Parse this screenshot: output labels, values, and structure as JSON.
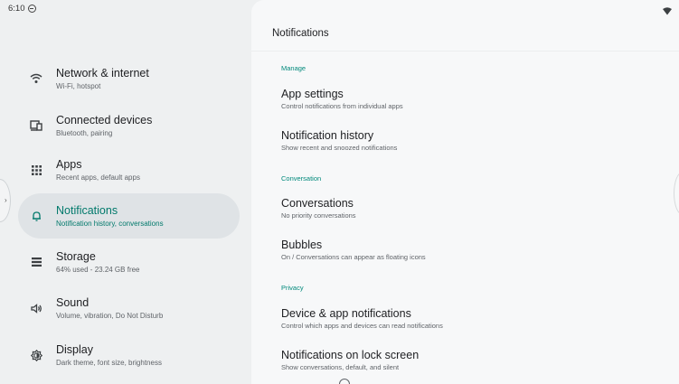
{
  "status_bar": {
    "time": "6:10",
    "icons": [
      "vpn-icon",
      "wifi-icon"
    ]
  },
  "sidebar": {
    "items": [
      {
        "title": "Network & internet",
        "subtitle": "Wi-Fi, hotspot",
        "icon": "wifi-icon",
        "active": false
      },
      {
        "title": "Connected devices",
        "subtitle": "Bluetooth, pairing",
        "icon": "connected-devices-icon",
        "active": false
      },
      {
        "title": "Apps",
        "subtitle": "Recent apps, default apps",
        "icon": "apps-grid-icon",
        "active": false
      },
      {
        "title": "Notifications",
        "subtitle": "Notification history, conversations",
        "icon": "bell-icon",
        "active": true
      },
      {
        "title": "Storage",
        "subtitle": "64% used - 23.24 GB free",
        "icon": "storage-icon",
        "active": false
      },
      {
        "title": "Sound",
        "subtitle": "Volume, vibration, Do Not Disturb",
        "icon": "speaker-icon",
        "active": false
      },
      {
        "title": "Display",
        "subtitle": "Dark theme, font size, brightness",
        "icon": "brightness-icon",
        "active": false
      }
    ],
    "active_color": "#00796b"
  },
  "main": {
    "title": "Notifications",
    "sections": [
      {
        "header": "Manage",
        "items": [
          {
            "title": "App settings",
            "subtitle": "Control notifications from individual apps"
          },
          {
            "title": "Notification history",
            "subtitle": "Show recent and snoozed notifications"
          }
        ]
      },
      {
        "header": "Conversation",
        "items": [
          {
            "title": "Conversations",
            "subtitle": "No priority conversations"
          },
          {
            "title": "Bubbles",
            "subtitle": "On / Conversations can appear as floating icons"
          }
        ]
      },
      {
        "header": "Privacy",
        "items": [
          {
            "title": "Device & app notifications",
            "subtitle": "Control which apps and devices can read notifications"
          },
          {
            "title": "Notifications on lock screen",
            "subtitle": "Show conversations, default, and silent"
          }
        ]
      }
    ],
    "accent_color": "#00897b"
  }
}
